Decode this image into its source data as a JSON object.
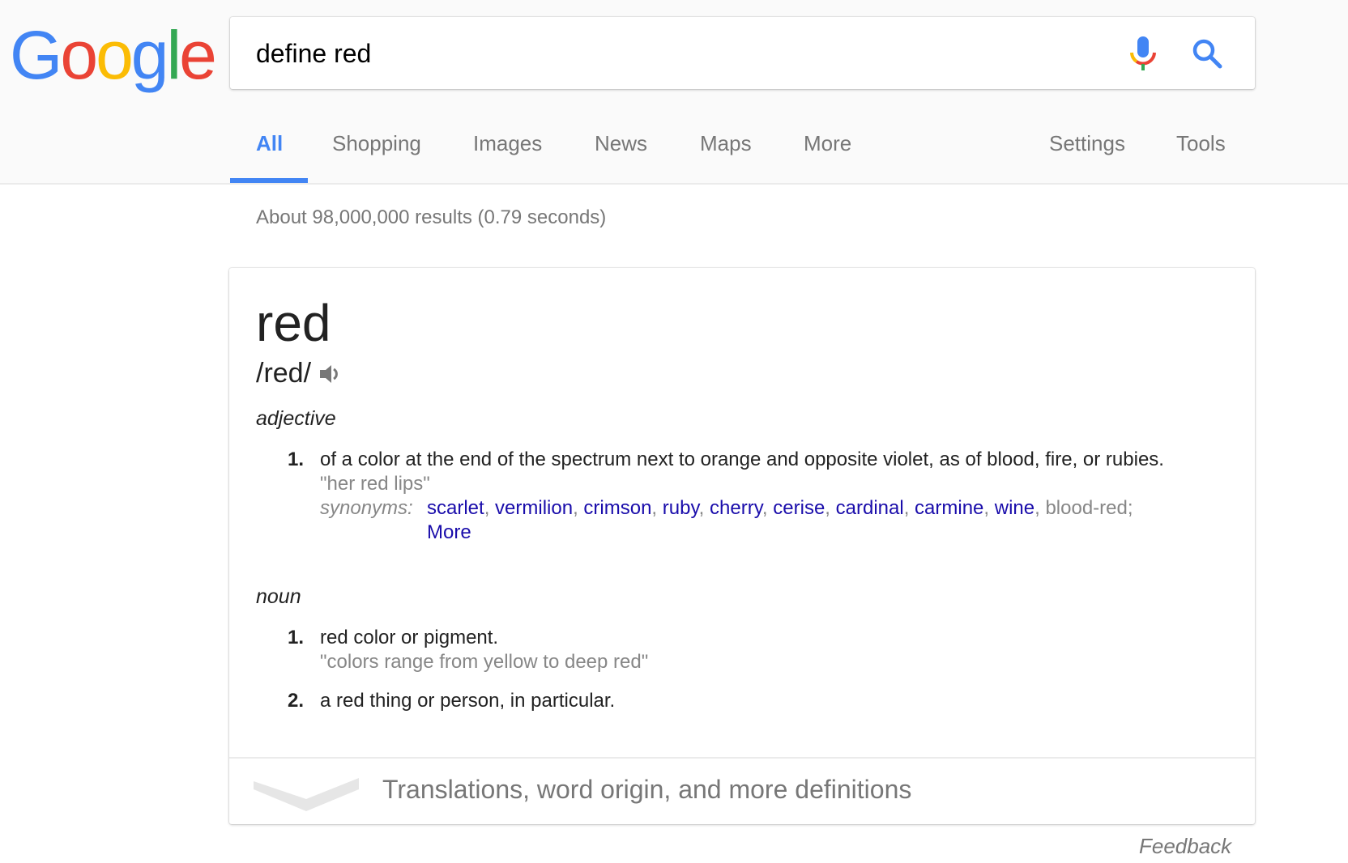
{
  "logo": {
    "letters": [
      "G",
      "o",
      "o",
      "g",
      "l",
      "e"
    ],
    "colors": {
      "blue": "#4285f4",
      "red": "#ea4335",
      "yellow": "#fbbc05",
      "green": "#34a853"
    }
  },
  "search": {
    "query": "define red",
    "mic_icon": "microphone-icon",
    "search_icon": "magnifier-icon"
  },
  "tabs": {
    "items": [
      {
        "label": "All",
        "active": true
      },
      {
        "label": "Shopping",
        "active": false
      },
      {
        "label": "Images",
        "active": false
      },
      {
        "label": "News",
        "active": false
      },
      {
        "label": "Maps",
        "active": false
      },
      {
        "label": "More",
        "active": false
      }
    ],
    "settings": "Settings",
    "tools": "Tools",
    "accent": "#4285f4"
  },
  "result_stats": "About 98,000,000 results (0.79 seconds)",
  "definition": {
    "word": "red",
    "phonetic": "/red/",
    "speaker_icon": "speaker-icon",
    "adjective": {
      "label": "adjective",
      "senses": [
        {
          "number": "1.",
          "text": "of a color at the end of the spectrum next to orange and opposite violet, as of blood, fire, or rubies.",
          "example": "\"her red lips\"",
          "synonyms_label": "synonyms:",
          "synonyms_links": [
            "scarlet",
            "vermilion",
            "crimson",
            "ruby",
            "cherry",
            "cerise",
            "cardinal",
            "carmine",
            "wine"
          ],
          "synonyms_plain": "blood-red;",
          "more_label": "More"
        }
      ]
    },
    "noun": {
      "label": "noun",
      "senses": [
        {
          "number": "1.",
          "text": "red color or pigment.",
          "example": "\"colors range from yellow to deep red\""
        },
        {
          "number": "2.",
          "text": "a red thing or person, in particular."
        }
      ]
    },
    "footer_text": "Translations, word origin, and more definitions",
    "link_color": "#1a0dab"
  },
  "feedback": "Feedback"
}
